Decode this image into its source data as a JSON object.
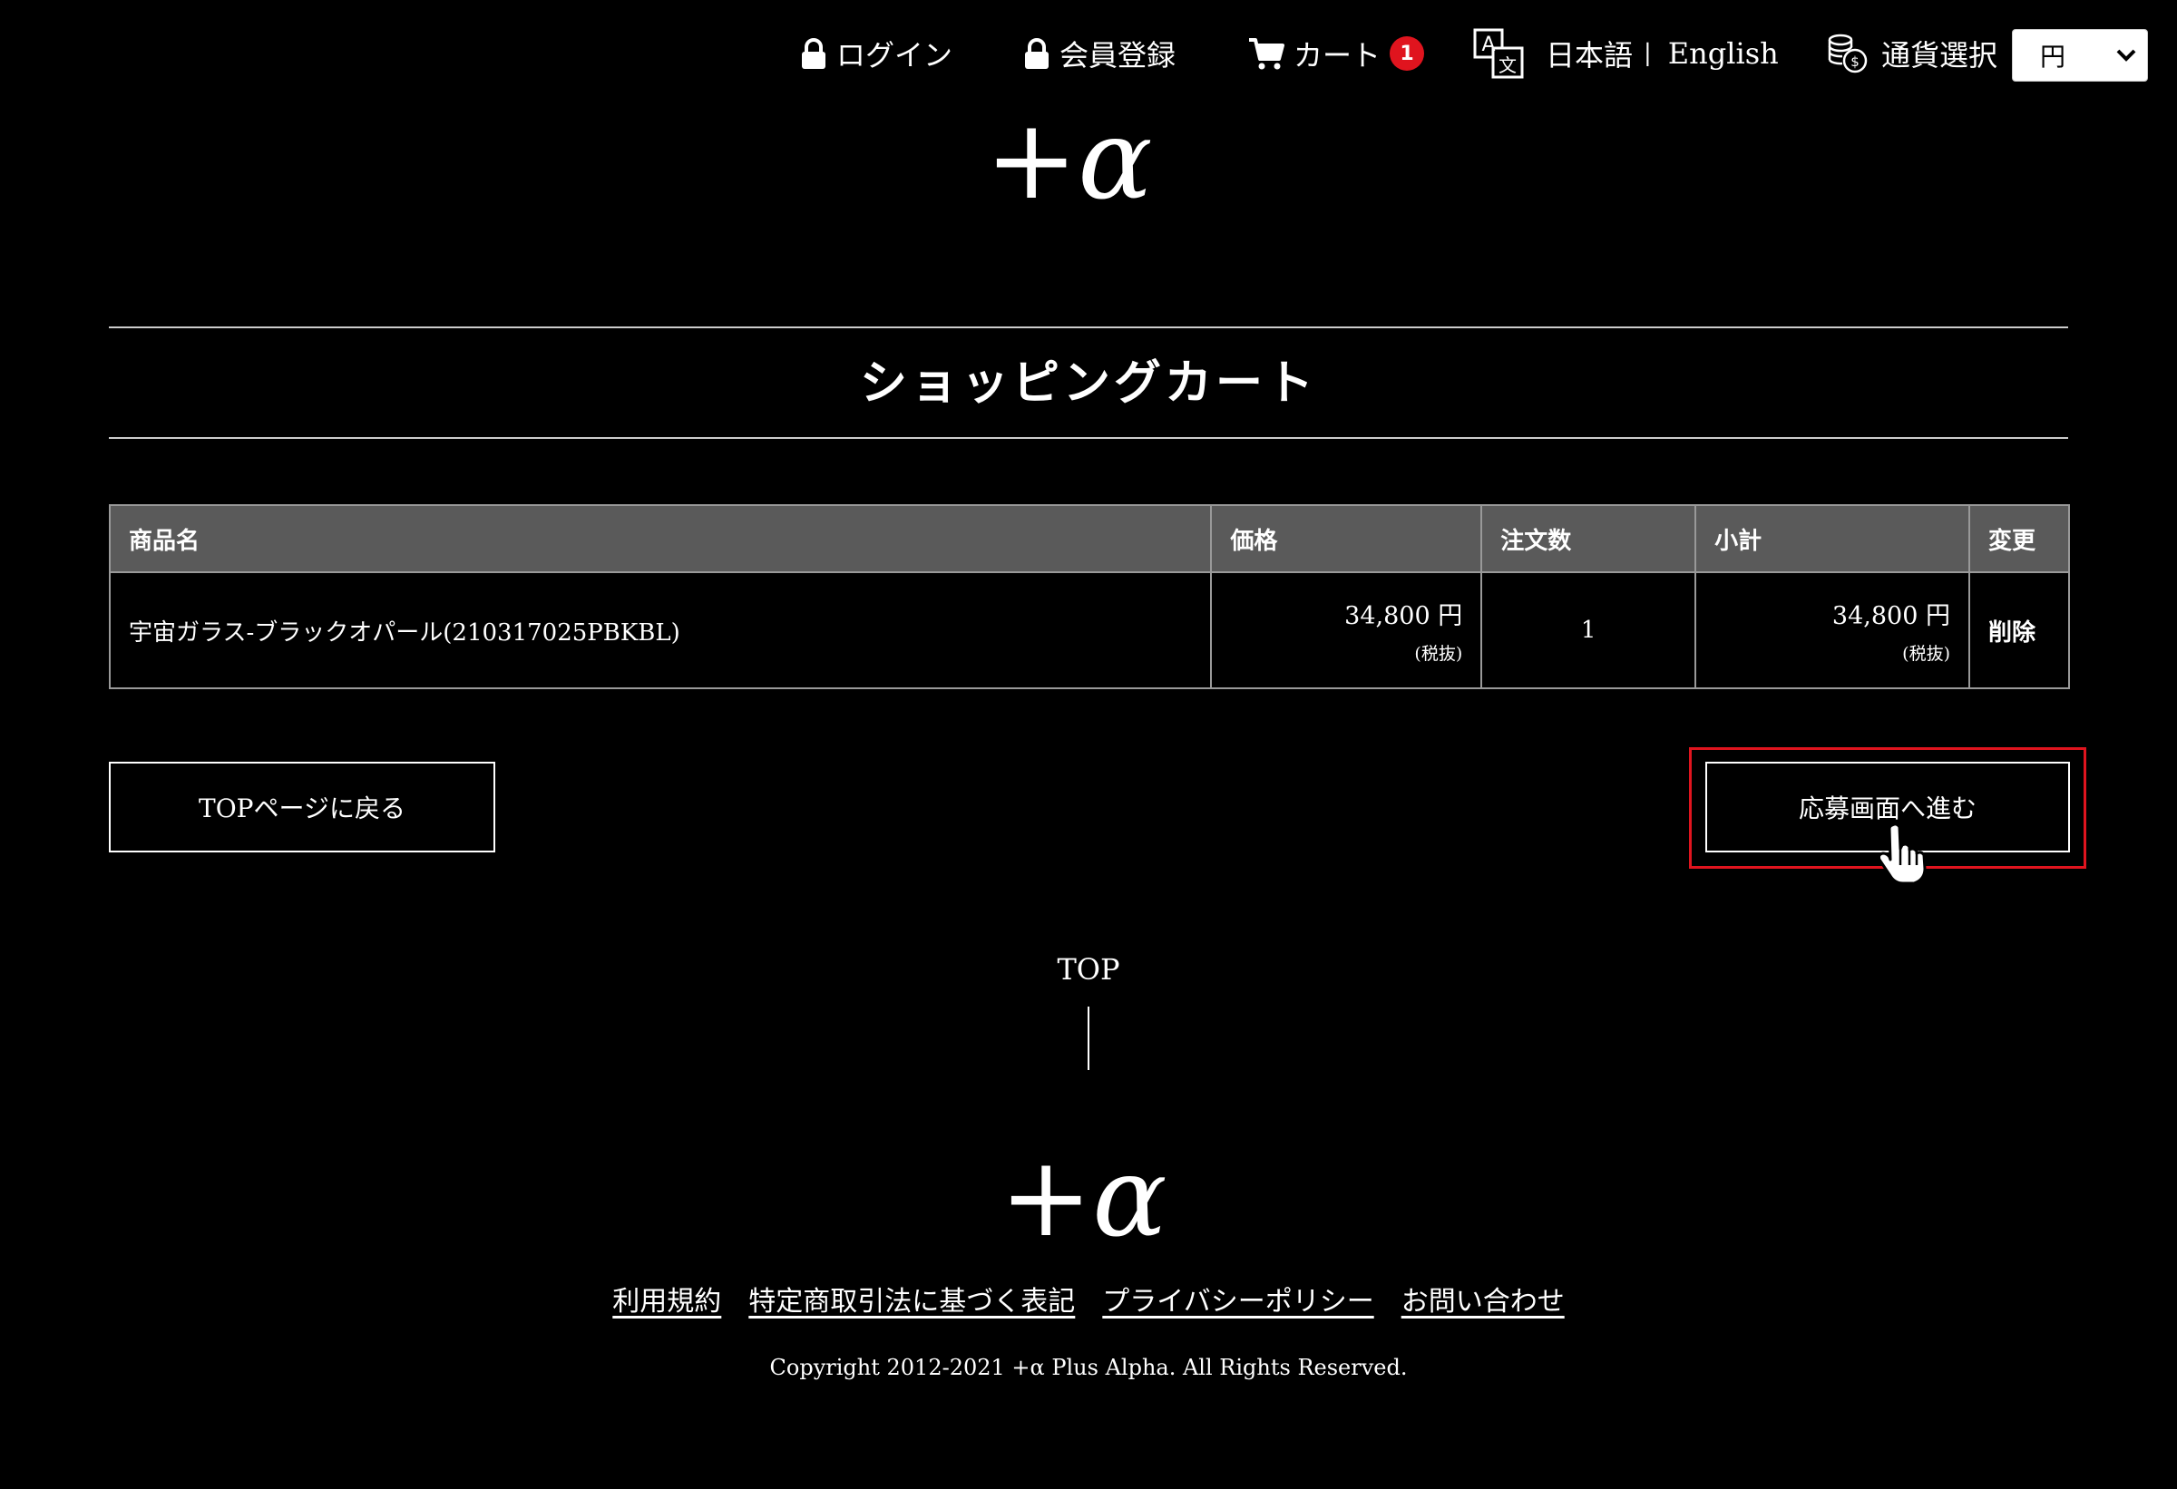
{
  "header": {
    "login_label": "ログイン",
    "register_label": "会員登録",
    "cart_label": "カート",
    "cart_count": "1",
    "lang_japanese": "日本語",
    "lang_separator": "|",
    "lang_english": "English",
    "currency_label": "通貨選択",
    "currency_value": "円"
  },
  "logo_text": "+α",
  "page_title": "ショッピングカート",
  "table": {
    "headers": [
      "商品名",
      "価格",
      "注文数",
      "小計",
      "変更"
    ],
    "rows": [
      {
        "name": "宇宙ガラス-ブラックオパール(210317025PBKBL)",
        "price": "34,800 円",
        "price_note": "(税抜)",
        "quantity": "1",
        "subtotal": "34,800 円",
        "subtotal_note": "(税抜)",
        "action": "削除"
      }
    ]
  },
  "buttons": {
    "back_top": "TOPページに戻る",
    "proceed": "応募画面へ進む"
  },
  "footer": {
    "top_label": "TOP",
    "links": [
      "利用規約",
      "特定商取引法に基づく表記",
      "プライバシーポリシー",
      "お問い合わせ"
    ],
    "copyright": "Copyright 2012-2021 +α Plus Alpha. All Rights Reserved."
  },
  "colors": {
    "background": "#000000",
    "badge": "#e0141e",
    "table_header": "#5a5a5a",
    "highlight": "#e0141e"
  },
  "icons": [
    "lock-icon",
    "cart-icon",
    "translate-icon",
    "coins-icon",
    "chevron-down-icon",
    "pointer-hand-icon"
  ]
}
